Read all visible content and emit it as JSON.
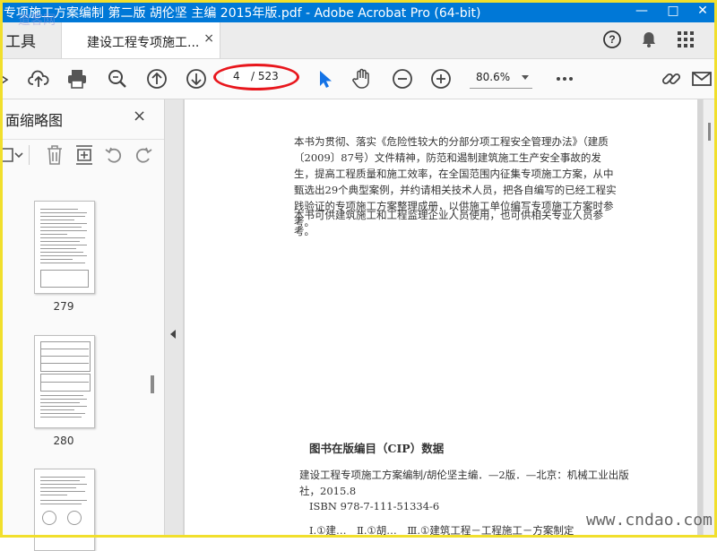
{
  "window": {
    "title": "专项施工方案编制 第二版 胡伦坚 主编 2015年版.pdf - Adobe Acrobat Pro (64-bit)"
  },
  "tabs": {
    "tools": "工具",
    "document": "建设工程专项施工...",
    "close": "×"
  },
  "toolbar": {
    "current_page": "4",
    "total_pages": "/ 523",
    "zoom": "80.6%"
  },
  "panel": {
    "title": "面缩略图",
    "close": "×",
    "thumbnails": [
      {
        "label": "279"
      },
      {
        "label": "280"
      }
    ]
  },
  "page": {
    "para1": "本书为贯彻、落实《危险性较大的分部分项工程安全管理办法》（建质〔2009〕87号）文件精神，防范和遏制建筑施工生产安全事故的发生，提高工程质量和施工效率，在全国范围内征集专项施工方案，从中甄选出29个典型案例，并约请相关技术人员，把各自编写的已经工程实践验证的专项施工方案整理成册，以供施工单位编写专项施工方案时参考。",
    "para2": "本书可供建筑施工和工程监理企业人员使用，也可供相关专业人员参考。",
    "cip_heading": "图书在版编目（CIP）数据",
    "cip_line1": "建设工程专项施工方案编制/胡伦坚主编．—2版．—北京：机械工业出版社，2015.8",
    "cip_line2": "ISBN 978-7-111-51334-6",
    "cip_line3": "Ⅰ.①建…　Ⅱ.①胡…　Ⅲ.①建筑工程－工程施工－方案制定"
  },
  "watermarks": {
    "top_left": "道客网",
    "bottom_right": "www.cndao.com"
  },
  "colors": {
    "titlebar": "#0078d7",
    "highlight_circle": "#e8161c",
    "frame": "#f1df2c"
  }
}
